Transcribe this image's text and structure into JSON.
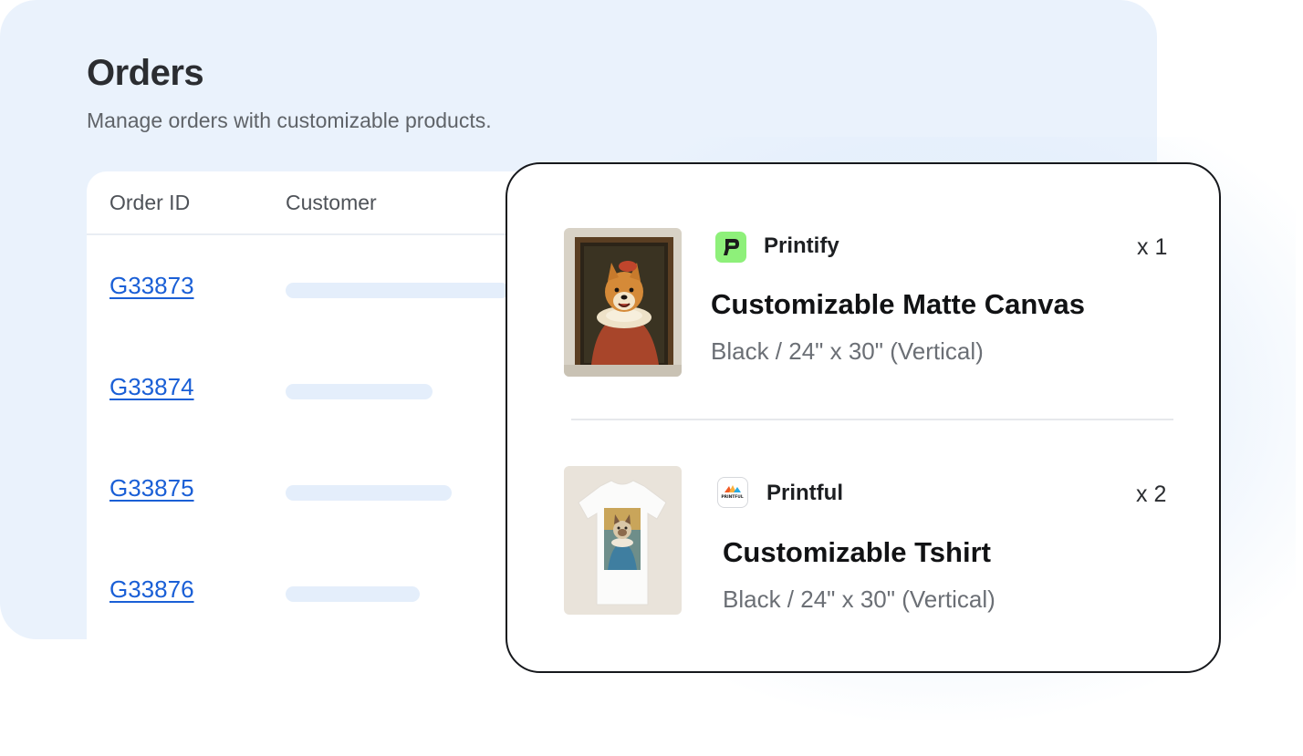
{
  "header": {
    "title": "Orders",
    "subtitle": "Manage orders with customizable products."
  },
  "table": {
    "columns": [
      "Order ID",
      "Customer"
    ],
    "rows": [
      {
        "order_id": "G33873",
        "customer_placeholder": true
      },
      {
        "order_id": "G33874",
        "customer_placeholder": true
      },
      {
        "order_id": "G33875",
        "customer_placeholder": true
      },
      {
        "order_id": "G33876",
        "customer_placeholder": true
      }
    ]
  },
  "order_items": [
    {
      "provider": "Printify",
      "provider_logo_color": "#8ef07a",
      "quantity": "x 1",
      "product": "Customizable Matte Canvas",
      "variant": "Black / 24\" x 30\" (Vertical)",
      "thumbnail": "framed-dog-portrait-canvas"
    },
    {
      "provider": "Printful",
      "provider_logo_text": "PRINTFUL",
      "quantity": "x 2",
      "product": "Customizable Tshirt",
      "variant": "Black / 24\" x 30\" (Vertical)",
      "thumbnail": "tshirt-with-cat-portrait"
    }
  ],
  "colors": {
    "panel_background": "#eaf2fc",
    "link": "#1a5fd6",
    "card_border": "#16181c"
  }
}
